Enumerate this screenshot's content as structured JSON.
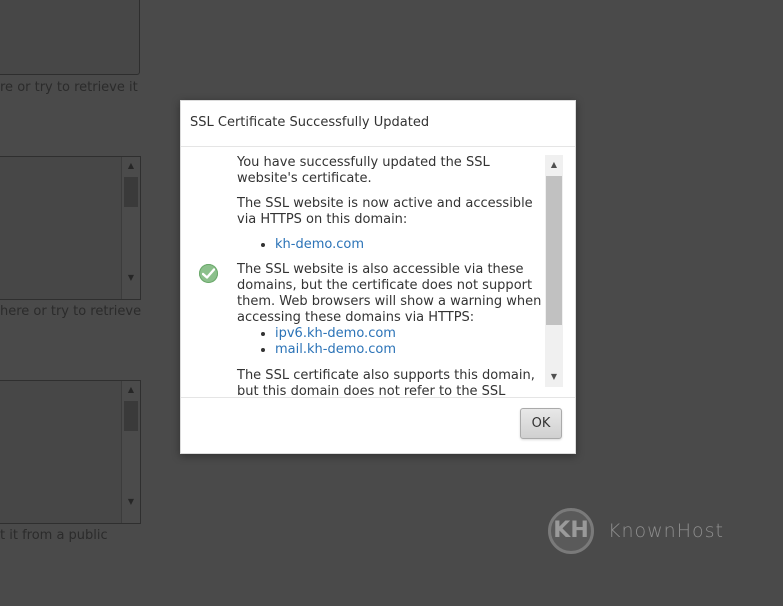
{
  "background": {
    "help_texts": [
      "re or try to retrieve it",
      "here or try to retrieve",
      "t it from a public"
    ]
  },
  "modal": {
    "title": "SSL Certificate Successfully Updated",
    "status_icon": "check-circle-icon",
    "paragraph_1": "You have successfully updated the SSL website's certificate.",
    "paragraph_2": "The SSL website is now active and accessible via HTTPS on this domain:",
    "primary_domain": "kh-demo.com",
    "paragraph_3": "The SSL website is also accessible via these domains, but the certificate does not support them. Web browsers will show a warning when accessing these domains via HTTPS:",
    "unsupported_domains": [
      "ipv6.kh-demo.com",
      "mail.kh-demo.com"
    ],
    "paragraph_4": "The SSL certificate also supports this domain, but this domain does not refer to the SSL website.",
    "ok_label": "OK"
  },
  "watermark": {
    "logo_mark": "KH",
    "brand": "KnownHost"
  },
  "colors": {
    "link": "#2b73b7",
    "success": "#8cc08c",
    "overlay": "#4a4a4a"
  }
}
